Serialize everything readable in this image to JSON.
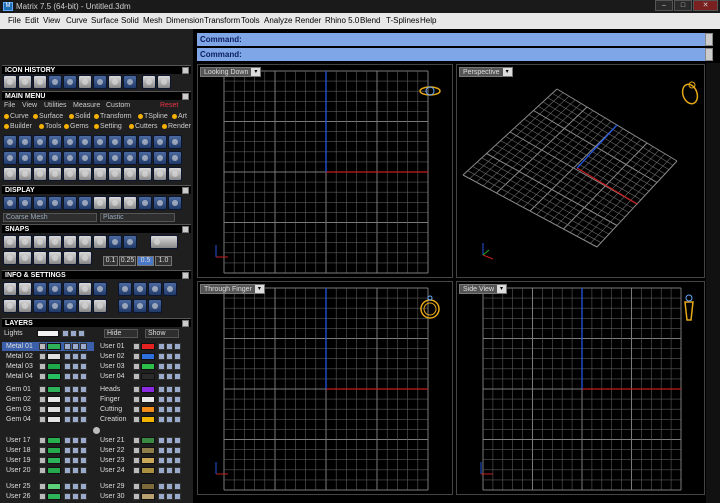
{
  "window": {
    "title": "Matrix 7.5 (64-bit) - Untitled.3dm",
    "logo": "M",
    "controls": [
      "–",
      "□",
      "✕"
    ]
  },
  "menu": [
    "File",
    "Edit",
    "View",
    "Curve",
    "Surface",
    "Solid",
    "Mesh",
    "Dimension",
    "Transform",
    "Tools",
    "Analyze",
    "Render",
    "Rhino 5.0",
    "Blend",
    "T-Splines",
    "Help"
  ],
  "command": {
    "line1": "Command:",
    "line2": "Command:"
  },
  "panels": {
    "icon_history": "ICON HISTORY",
    "main_menu": "MAIN MENU",
    "main_menu_items": [
      "File",
      "View",
      "Utilities",
      "Measure",
      "Custom"
    ],
    "reset": "Reset",
    "builder_row1": [
      "Curve",
      "Surface",
      "Solid",
      "Transform",
      "TSpline",
      "Art"
    ],
    "builder_row2": [
      "Builder",
      "Tools",
      "Gems",
      "Setting",
      "Cutters",
      "Render"
    ],
    "display": "DISPLAY",
    "display_mesh": "Coarse Mesh",
    "display_material": "Plastic",
    "snaps": "SNAPS",
    "snap_values": [
      "0.1",
      "0.25",
      "0.5",
      "1.0"
    ],
    "info": "INFO & SETTINGS",
    "layers": "LAYERS",
    "lights": "Lights",
    "hide": "Hide",
    "show": "Show"
  },
  "layers_left": [
    {
      "name": "Metal 01",
      "color": "#2fb35a"
    },
    {
      "name": "Metal 02",
      "color": "#e0e0e0"
    },
    {
      "name": "Metal 03",
      "color": "#1fa84a"
    },
    {
      "name": "Metal 04",
      "color": "#27c060"
    },
    {
      "name": "Gem 01",
      "color": "#2fb35a"
    },
    {
      "name": "Gem 02",
      "color": "#e8e8e8"
    },
    {
      "name": "Gem 03",
      "color": "#e0e0e0"
    },
    {
      "name": "Gem 04",
      "color": "#e3e3e3"
    },
    {
      "name": "User 17",
      "color": "#28b050"
    },
    {
      "name": "User 18",
      "color": "#26a84c"
    },
    {
      "name": "User 19",
      "color": "#2cb35a"
    },
    {
      "name": "User 20",
      "color": "#26a84c"
    },
    {
      "name": "User 25",
      "color": "#5dd07a"
    },
    {
      "name": "User 26",
      "color": "#2fb35a"
    }
  ],
  "layers_right": [
    {
      "name": "User 01",
      "color": "#e52222"
    },
    {
      "name": "User 02",
      "color": "#2e6fe0"
    },
    {
      "name": "User 03",
      "color": "#2cc04a"
    },
    {
      "name": "User 04",
      "color": "#2a2a2a"
    },
    {
      "name": "Heads",
      "color": "#8a2be2"
    },
    {
      "name": "Finger",
      "color": "#e8e8e8"
    },
    {
      "name": "Cutting",
      "color": "#f28c1a"
    },
    {
      "name": "Creation",
      "color": "#f2b400"
    },
    {
      "name": "User 21",
      "color": "#3a8a44"
    },
    {
      "name": "User 22",
      "color": "#8f7f4a"
    },
    {
      "name": "User 23",
      "color": "#c9a85a"
    },
    {
      "name": "User 24",
      "color": "#a89040"
    },
    {
      "name": "User 29",
      "color": "#7c6a3a"
    },
    {
      "name": "User 30",
      "color": "#b8a070"
    }
  ],
  "viewports": [
    {
      "name": "Looking Down"
    },
    {
      "name": "Perspective"
    },
    {
      "name": "Through Finger"
    },
    {
      "name": "Side View"
    }
  ],
  "colors": {
    "grid": "#5a5a5a",
    "axis_x": "#c41e1e",
    "axis_y": "#2255dd",
    "gizmo": "#e6a817"
  }
}
